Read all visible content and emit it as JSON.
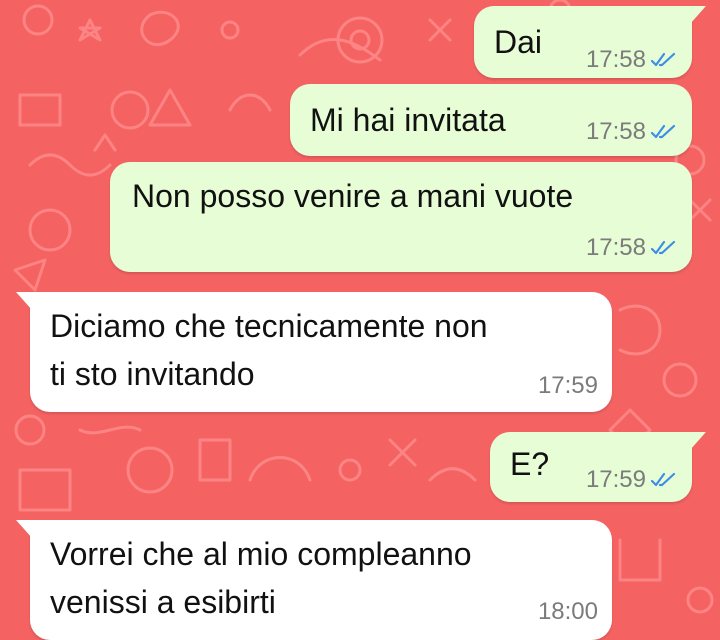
{
  "theme": {
    "wallpaper_color": "#f46262",
    "outgoing_bubble_color": "#e7fdd6",
    "incoming_bubble_color": "#ffffff",
    "tick_color": "#3d8ee6"
  },
  "messages": [
    {
      "direction": "outgoing",
      "text": "Dai",
      "time": "17:58",
      "status_icon": "double-check-read-icon"
    },
    {
      "direction": "outgoing",
      "text": "Mi hai invitata",
      "time": "17:58",
      "status_icon": "double-check-read-icon"
    },
    {
      "direction": "outgoing",
      "text": "Non posso venire a mani vuote",
      "time": "17:58",
      "status_icon": "double-check-read-icon"
    },
    {
      "direction": "incoming",
      "line1": "Diciamo che tecnicamente non",
      "line2": "ti sto invitando",
      "time": "17:59"
    },
    {
      "direction": "outgoing",
      "text": "E?",
      "time": "17:59",
      "status_icon": "double-check-read-icon"
    },
    {
      "direction": "incoming",
      "line1": "Vorrei che al mio compleanno",
      "line2": "venissi a esibirti",
      "time": "18:00"
    }
  ]
}
